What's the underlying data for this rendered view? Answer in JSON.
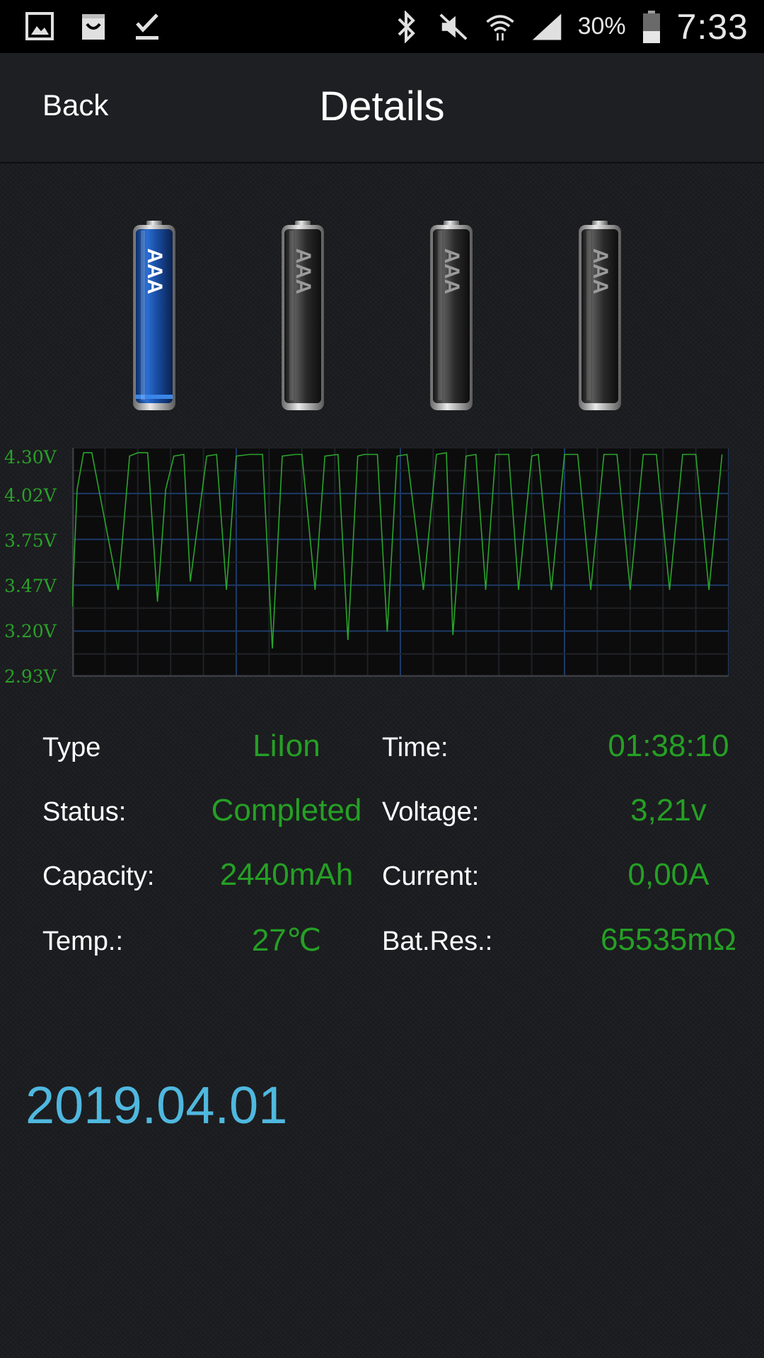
{
  "status_bar": {
    "left_icons": [
      "gallery-icon",
      "shopping-bag-icon",
      "download-done-icon"
    ],
    "right_icons": [
      "bluetooth-icon",
      "mute-icon",
      "wifi-icon",
      "signal-icon",
      "battery-icon"
    ],
    "battery_percent": "30%",
    "clock": "7:33"
  },
  "header": {
    "back_label": "Back",
    "title": "Details"
  },
  "slots": [
    {
      "label": "AAA",
      "active": true
    },
    {
      "label": "AAA",
      "active": false
    },
    {
      "label": "AAA",
      "active": false
    },
    {
      "label": "AAA",
      "active": false
    }
  ],
  "chart_data": {
    "type": "line",
    "y_tick_labels": [
      "4.30V",
      "4.02V",
      "3.75V",
      "3.47V",
      "3.20V",
      "2.93V"
    ],
    "ylim": [
      2.93,
      4.3
    ],
    "x_range": [
      0,
      20
    ],
    "grid": true,
    "series": [
      {
        "color": "#2aa52a",
        "x": [
          0.0,
          0.15,
          0.35,
          0.6,
          1.4,
          1.75,
          2.0,
          2.3,
          2.6,
          2.85,
          3.1,
          3.4,
          3.6,
          4.1,
          4.4,
          4.7,
          5.0,
          5.4,
          5.8,
          6.1,
          6.4,
          6.8,
          7.0,
          7.4,
          7.7,
          8.1,
          8.4,
          8.7,
          8.9,
          9.3,
          9.6,
          9.9,
          10.2,
          10.7,
          11.1,
          11.4,
          11.6,
          12.0,
          12.3,
          12.6,
          12.9,
          13.3,
          13.6,
          14.0,
          14.2,
          14.6,
          15.0,
          15.4,
          15.8,
          16.2,
          16.6,
          17.0,
          17.4,
          17.8,
          18.2,
          18.6,
          19.0,
          19.4,
          19.8
        ],
        "y": [
          3.35,
          4.05,
          4.27,
          4.27,
          3.45,
          4.25,
          4.27,
          4.27,
          3.38,
          4.05,
          4.25,
          4.26,
          3.5,
          4.25,
          4.26,
          3.45,
          4.25,
          4.26,
          4.26,
          3.1,
          4.25,
          4.26,
          4.26,
          3.45,
          4.25,
          4.26,
          3.15,
          4.25,
          4.26,
          4.26,
          3.2,
          4.25,
          4.26,
          3.45,
          4.26,
          4.27,
          3.18,
          4.25,
          4.26,
          3.45,
          4.26,
          4.26,
          3.45,
          4.25,
          4.26,
          3.45,
          4.26,
          4.26,
          3.45,
          4.26,
          4.26,
          3.45,
          4.26,
          4.26,
          3.45,
          4.26,
          4.26,
          3.45,
          4.26
        ]
      }
    ]
  },
  "info": {
    "type_label": "Type",
    "type_value": "LiIon",
    "status_label": "Status:",
    "status_value": "Completed",
    "capacity_label": "Capacity:",
    "capacity_value": "2440mAh",
    "temp_label": "Temp.:",
    "temp_value": "27℃",
    "time_label": "Time:",
    "time_value": "01:38:10",
    "voltage_label": "Voltage:",
    "voltage_value": "3,21v",
    "current_label": "Current:",
    "current_value": "0,00A",
    "res_label": "Bat.Res.:",
    "res_value": "65535mΩ"
  },
  "date": "2019.04.01",
  "colors": {
    "value_green": "#25a025",
    "date_blue": "#4fb8df",
    "battery_blue": "#1a5fb4"
  }
}
